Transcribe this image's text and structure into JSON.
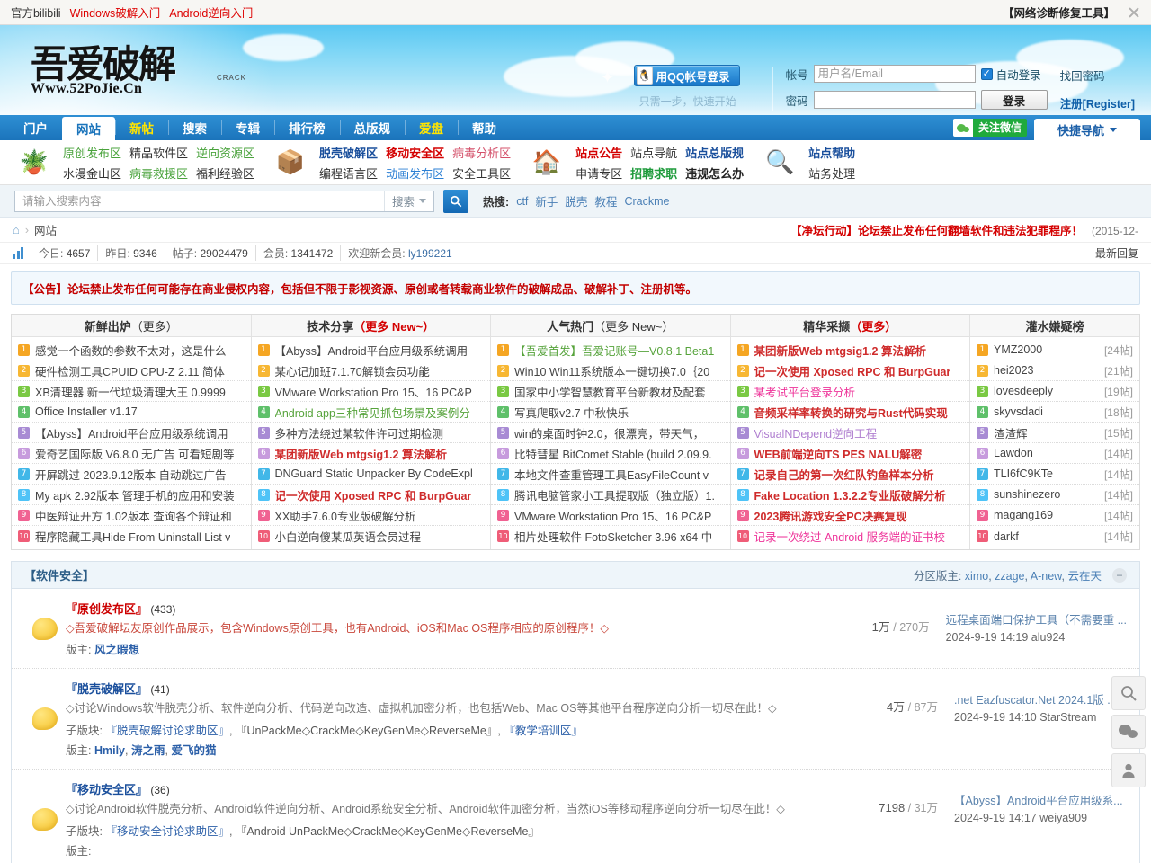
{
  "topbar": {
    "links": [
      {
        "label": "官方bilibili",
        "style": "plain"
      },
      {
        "label": "Windows破解入门",
        "style": "red"
      },
      {
        "label": "Android逆向入门",
        "style": "red"
      }
    ],
    "tool_label": "【网络诊断修复工具】",
    "shrink_icon": "shrink-icon"
  },
  "banner": {
    "logo_cn": "吾爱破解",
    "logo_url": "Www.52PoJie.Cn",
    "logo_crack": "CRACK",
    "login": {
      "qq_button": "用QQ帐号登录",
      "qq_sub": "只需一步，快速开始",
      "account_label": "帐号",
      "account_placeholder": "用户名/Email",
      "account_value": "",
      "password_label": "密码",
      "password_value": "",
      "autologin_label": "自动登录",
      "login_button": "登录",
      "find_password": "找回密码",
      "register": "注册[Register]"
    }
  },
  "nav": {
    "tabs": [
      {
        "label": "门户",
        "state": "normal"
      },
      {
        "label": "网站",
        "state": "active"
      },
      {
        "label": "新帖",
        "state": "highlight"
      },
      {
        "label": "搜索",
        "state": "normal"
      },
      {
        "label": "专辑",
        "state": "normal"
      },
      {
        "label": "排行榜",
        "state": "normal"
      },
      {
        "label": "总版规",
        "state": "normal"
      },
      {
        "label": "爱盘",
        "state": "highlight"
      },
      {
        "label": "帮助",
        "state": "normal"
      }
    ],
    "wechat_label": "关注微信",
    "quicknav_label": "快捷导航"
  },
  "categories": [
    {
      "icon": "plant-pot-icon",
      "glyph": "🪴",
      "row1": [
        {
          "label": "原创发布区",
          "color": "#4aa33c"
        },
        {
          "label": "精品软件区",
          "color": "#333"
        },
        {
          "label": "逆向资源区",
          "color": "#4aa33c"
        }
      ],
      "row2": [
        {
          "label": "水漫金山区",
          "color": "#333"
        },
        {
          "label": "病毒救援区",
          "color": "#4aa33c"
        },
        {
          "label": "福利经验区",
          "color": "#333"
        }
      ]
    },
    {
      "icon": "open-box-icon",
      "glyph": "📦",
      "row1": [
        {
          "label": "脱壳破解区",
          "color": "#1a4f9c",
          "bold": true
        },
        {
          "label": "移动安全区",
          "color": "#d40000",
          "bold": true
        },
        {
          "label": "病毒分析区",
          "color": "#d4506a"
        }
      ],
      "row2": [
        {
          "label": "编程语言区",
          "color": "#333"
        },
        {
          "label": "动画发布区",
          "color": "#2b7fd4"
        },
        {
          "label": "安全工具区",
          "color": "#333"
        }
      ]
    },
    {
      "icon": "house-icon",
      "glyph": "🏠",
      "row1": [
        {
          "label": "站点公告",
          "color": "#d40000",
          "bold": true
        },
        {
          "label": "站点导航",
          "color": "#333"
        },
        {
          "label": "站点总版规",
          "color": "#1a4f9c",
          "bold": true
        }
      ],
      "row2": [
        {
          "label": "申请专区",
          "color": "#333"
        },
        {
          "label": "招聘求职",
          "color": "#1f9b3c",
          "bold": true
        },
        {
          "label": "违规怎么办",
          "color": "#222",
          "bold": true
        }
      ]
    },
    {
      "icon": "magnifier-icon",
      "glyph": "🔍",
      "row1": [
        {
          "label": "站点帮助",
          "color": "#1a4f9c",
          "bold": true
        }
      ],
      "row2": [
        {
          "label": "站务处理",
          "color": "#333"
        }
      ]
    }
  ],
  "search": {
    "placeholder": "请输入搜索内容",
    "value": "",
    "scope_label": "搜索",
    "button_icon": "search-icon",
    "hot_label": "热搜:",
    "hot_terms": [
      "ctf",
      "新手",
      "脱壳",
      "教程",
      "Crackme"
    ]
  },
  "breadcrumb": {
    "home_icon": "home-icon",
    "current": "网站",
    "notice_title": "【净坛行动】论坛禁止发布任何翻墙软件和违法犯罪程序！",
    "notice_date": "(2015-12-"
  },
  "stats": {
    "today_label": "今日:",
    "today_value": "4657",
    "yesterday_label": "昨日:",
    "yesterday_value": "9346",
    "posts_label": "帖子:",
    "posts_value": "29024479",
    "members_label": "会员:",
    "members_value": "1341472",
    "welcome_label": "欢迎新会员:",
    "welcome_value": "ly199221",
    "latest_reply": "最新回复"
  },
  "announcement": "【公告】论坛禁止发布任何可能存在商业侵权内容，包括但不限于影视资源、原创或者转载商业软件的破解成品、破解补丁、注册机等。",
  "boards": [
    {
      "title": "新鲜出炉",
      "more": "（更多）",
      "more_red": false,
      "items": [
        {
          "text": "感觉一个函数的参数不太对，这是什么",
          "style": "norm"
        },
        {
          "text": "硬件检测工具CPUID CPU-Z 2.11 简体",
          "style": "norm"
        },
        {
          "text": "XB清理器 新一代垃圾清理大王 0.9999",
          "style": "norm"
        },
        {
          "text": "Office Installer v1.17",
          "style": "norm"
        },
        {
          "text": "【Abyss】Android平台应用级系统调用",
          "style": "norm"
        },
        {
          "text": "爱奇艺国际版 V6.8.0 无广告 可看短剧等",
          "style": "norm"
        },
        {
          "text": "开屏跳过 2023.9.12版本 自动跳过广告",
          "style": "norm"
        },
        {
          "text": "My apk 2.92版本 管理手机的应用和安装",
          "style": "norm"
        },
        {
          "text": "中医辩证开方 1.02版本 查询各个辩证和",
          "style": "norm"
        },
        {
          "text": "程序隐藏工具Hide From Uninstall List v",
          "style": "norm"
        }
      ]
    },
    {
      "title": "技术分享",
      "more": "（更多 New~）",
      "more_red": true,
      "items": [
        {
          "text": "【Abyss】Android平台应用级系统调用",
          "style": "norm"
        },
        {
          "text": "某心记加班7.1.70解锁会员功能",
          "style": "norm"
        },
        {
          "text": "VMware Workstation Pro 15、16 PC&P",
          "style": "norm"
        },
        {
          "text": "Android app三种常见抓包场景及案例分",
          "style": "green"
        },
        {
          "text": "多种方法绕过某软件许可过期检测",
          "style": "norm"
        },
        {
          "text": "某团新版Web mtgsig1.2 算法解析",
          "style": "mred"
        },
        {
          "text": "DNGuard Static Unpacker By CodeExpl",
          "style": "norm"
        },
        {
          "text": "记一次使用 Xposed RPC 和 BurpGuar",
          "style": "mred"
        },
        {
          "text": "XX助手7.6.0专业版破解分析",
          "style": "norm"
        },
        {
          "text": "小白逆向傻某瓜英语会员过程",
          "style": "norm"
        }
      ]
    },
    {
      "title": "人气热门",
      "more": "（更多 New~）",
      "more_red": false,
      "items": [
        {
          "text": "【吾爱首发】吾爱记账号—V0.8.1 Beta1",
          "style": "green"
        },
        {
          "text": "Win10 Win11系统版本一键切换7.0｛20",
          "style": "norm"
        },
        {
          "text": "国家中小学智慧教育平台新教材及配套",
          "style": "norm"
        },
        {
          "text": "写真爬取v2.7 中秋快乐",
          "style": "norm"
        },
        {
          "text": "win的桌面时钟2.0，很漂亮，带天气，",
          "style": "norm"
        },
        {
          "text": "比特彗星 BitComet Stable (build 2.09.9.",
          "style": "norm"
        },
        {
          "text": "本地文件查重管理工具EasyFileCount v",
          "style": "norm"
        },
        {
          "text": "腾讯电脑管家小工具提取版（独立版）1.",
          "style": "norm"
        },
        {
          "text": "VMware Workstation Pro 15、16 PC&P",
          "style": "norm"
        },
        {
          "text": "相片处理软件 FotoSketcher 3.96 x64 中",
          "style": "norm"
        }
      ]
    },
    {
      "title": "精华采撷",
      "more": "（更多）",
      "more_red": true,
      "items": [
        {
          "text": "某团新版Web mtgsig1.2 算法解析",
          "style": "mred"
        },
        {
          "text": "记一次使用 Xposed RPC 和 BurpGuar",
          "style": "mred"
        },
        {
          "text": "某考试平台登录分析",
          "style": "pink"
        },
        {
          "text": "音频采样率转换的研究与Rust代码实现",
          "style": "mred"
        },
        {
          "text": "VisualNDepend逆向工程",
          "style": "purple"
        },
        {
          "text": "WEB前端逆向TS PES NALU解密",
          "style": "mred"
        },
        {
          "text": "记录自己的第一次红队钓鱼样本分析",
          "style": "mred"
        },
        {
          "text": "Fake Location 1.3.2.2专业版破解分析",
          "style": "mred"
        },
        {
          "text": "2023腾讯游戏安全PC决赛复现",
          "style": "mred"
        },
        {
          "text": "记录一次绕过 Android 服务端的证书校",
          "style": "pink"
        }
      ]
    }
  ],
  "ranking": {
    "title": "灌水嫌疑榜",
    "items": [
      {
        "name": "YMZ2000",
        "count": "[24帖]"
      },
      {
        "name": "hei2023",
        "count": "[21帖]"
      },
      {
        "name": "lovesdeeply",
        "count": "[19帖]"
      },
      {
        "name": "skyvsdadi",
        "count": "[18帖]"
      },
      {
        "name": "渣渣辉",
        "count": "[15帖]"
      },
      {
        "name": "Lawdon",
        "count": "[14帖]"
      },
      {
        "name": "TLI6fC9KTe",
        "count": "[14帖]"
      },
      {
        "name": "sunshinezero",
        "count": "[14帖]"
      },
      {
        "name": "magang169",
        "count": "[14帖]"
      },
      {
        "name": "darkf",
        "count": "[14帖]"
      }
    ]
  },
  "forum_section": {
    "title": "【软件安全】",
    "mods_label": "分区版主:",
    "mods": [
      "ximo",
      "zzage",
      "A-new",
      "云在天"
    ],
    "collapse_icon": "collapse-icon",
    "rows": [
      {
        "title": "『原创发布区』",
        "count": "(433)",
        "desc": "◇吾爱破解坛友原创作品展示，包含Windows原创工具，也有Android、iOS和Mac OS程序相应的原创程序！◇",
        "desc_red": true,
        "sub_label": "",
        "subs": [],
        "mod_label": "版主:",
        "mods": [
          "风之暇想"
        ],
        "threads": "1万",
        "posts": "270万",
        "last_title": "远程桌面端口保护工具（不需要重 ...",
        "last_meta": "2024-9-19 14:19 alu924"
      },
      {
        "title": "『脱壳破解区』",
        "count": "(41)",
        "desc": "◇讨论Windows软件脱壳分析、软件逆向分析、代码逆向改造、虚拟机加密分析，也包括Web、Mac OS等其他平台程序逆向分析一切尽在此！◇",
        "desc_red": false,
        "sub_label": "子版块:",
        "subs": [
          "『脱壳破解讨论求助区』",
          "『UnPackMe◇CrackMe◇KeyGenMe◇ReverseMe』",
          "『教学培训区』"
        ],
        "mod_label": "版主:",
        "mods": [
          "Hmily",
          "涛之雨",
          "爱飞的猫"
        ],
        "threads": "4万",
        "posts": "87万",
        "last_title": ".net Eazfuscator.Net 2024.1版 ...",
        "last_meta": "2024-9-19 14:10 StarStream"
      },
      {
        "title": "『移动安全区』",
        "count": "(36)",
        "desc": "◇讨论Android软件脱壳分析、Android软件逆向分析、Android系统安全分析、Android软件加密分析，当然iOS等移动程序逆向分析一切尽在此！◇",
        "desc_red": false,
        "sub_label": "子版块:",
        "subs": [
          "『移动安全讨论求助区』",
          "『Android UnPackMe◇CrackMe◇KeyGenMe◇ReverseMe』"
        ],
        "mod_label": "版主:",
        "mods": [
          "",
          "",
          ""
        ],
        "threads": "7198",
        "posts": "31万",
        "last_title": "【Abyss】Android平台应用级系...",
        "last_meta": "2024-9-19 14:17 weiya909"
      }
    ]
  },
  "sidefloat": [
    {
      "icon": "search-icon"
    },
    {
      "icon": "wechat-icon"
    },
    {
      "icon": "user-icon"
    }
  ]
}
